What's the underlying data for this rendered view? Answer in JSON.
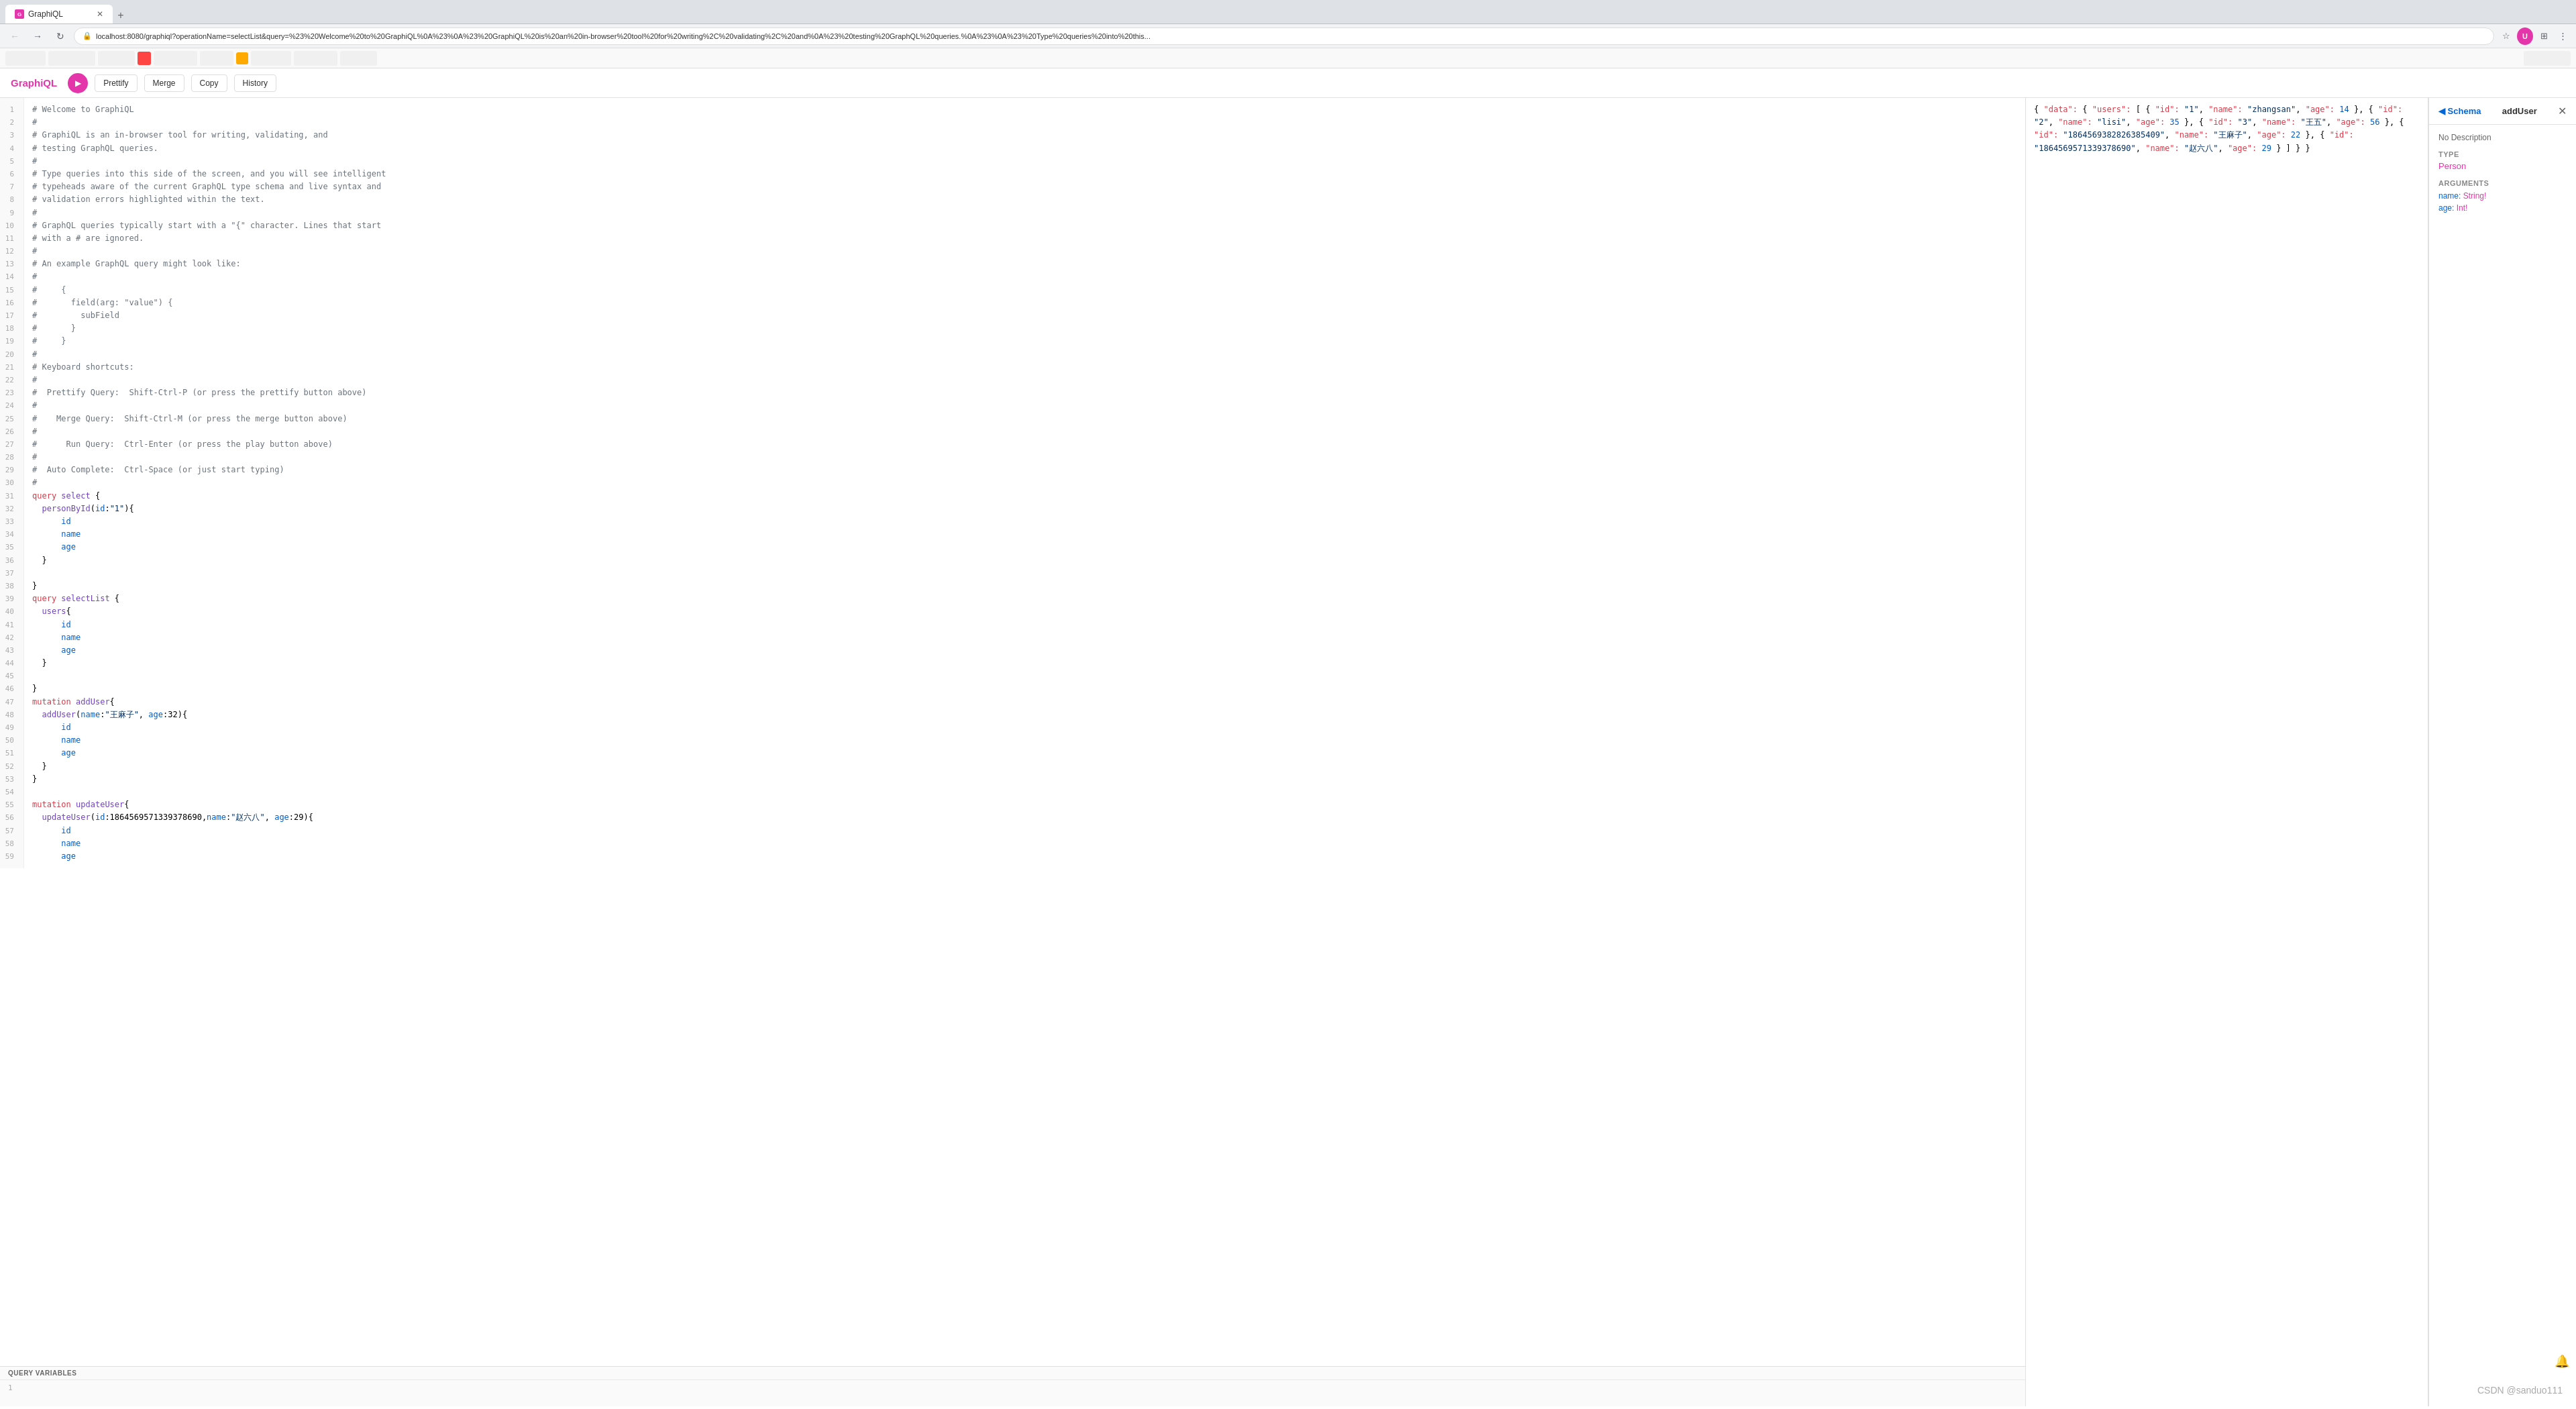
{
  "browser": {
    "tab_title": "GraphiQL",
    "url": "localhost:8080/graphiql?operationName=selectList&query=%23%20Welcome%20to%20GraphiQL%0A%23%0A%23%20GraphiQL%20is%20an%20in-browser%20tool%20for%20writing%2C%20validating%2C%20and%0A%23%20testing%20GraphQL%20queries.%0A%23%0A%23%20Type%20queries%20into%20this..."
  },
  "app": {
    "title": "GraphiQL",
    "play_label": "▶",
    "prettify_label": "Prettify",
    "merge_label": "Merge",
    "copy_label": "Copy",
    "history_label": "History"
  },
  "editor": {
    "content_lines": [
      {
        "num": 1,
        "text": "# Welcome to GraphiQL",
        "type": "comment"
      },
      {
        "num": 2,
        "text": "#",
        "type": "comment"
      },
      {
        "num": 3,
        "text": "# GraphiQL is an in-browser tool for writing, validating, and",
        "type": "comment"
      },
      {
        "num": 4,
        "text": "# testing GraphQL queries.",
        "type": "comment"
      },
      {
        "num": 5,
        "text": "#",
        "type": "comment"
      },
      {
        "num": 6,
        "text": "# Type queries into this side of the screen, and you will see intelligent",
        "type": "comment"
      },
      {
        "num": 7,
        "text": "# typeheads aware of the current GraphQL type schema and live syntax and",
        "type": "comment"
      },
      {
        "num": 8,
        "text": "# validation errors highlighted within the text.",
        "type": "comment"
      },
      {
        "num": 9,
        "text": "#",
        "type": "comment"
      },
      {
        "num": 10,
        "text": "# GraphQL queries typically start with a \"{\" character. Lines that start",
        "type": "comment"
      },
      {
        "num": 11,
        "text": "# with a # are ignored.",
        "type": "comment"
      },
      {
        "num": 12,
        "text": "#",
        "type": "comment"
      },
      {
        "num": 13,
        "text": "# An example GraphQL query might look like:",
        "type": "comment"
      },
      {
        "num": 14,
        "text": "#",
        "type": "comment"
      },
      {
        "num": 15,
        "text": "#     {",
        "type": "comment"
      },
      {
        "num": 16,
        "text": "#       field(arg: \"value\") {",
        "type": "comment"
      },
      {
        "num": 17,
        "text": "#         subField",
        "type": "comment"
      },
      {
        "num": 18,
        "text": "#       }",
        "type": "comment"
      },
      {
        "num": 19,
        "text": "#     }",
        "type": "comment"
      },
      {
        "num": 20,
        "text": "#",
        "type": "comment"
      },
      {
        "num": 21,
        "text": "# Keyboard shortcuts:",
        "type": "comment"
      },
      {
        "num": 22,
        "text": "#",
        "type": "comment"
      },
      {
        "num": 23,
        "text": "#  Prettify Query:  Shift-Ctrl-P (or press the prettify button above)",
        "type": "comment"
      },
      {
        "num": 24,
        "text": "#",
        "type": "comment"
      },
      {
        "num": 25,
        "text": "#    Merge Query:  Shift-Ctrl-M (or press the merge button above)",
        "type": "comment"
      },
      {
        "num": 26,
        "text": "#",
        "type": "comment"
      },
      {
        "num": 27,
        "text": "#      Run Query:  Ctrl-Enter (or press the play button above)",
        "type": "comment"
      },
      {
        "num": 28,
        "text": "#",
        "type": "comment"
      },
      {
        "num": 29,
        "text": "#  Auto Complete:  Ctrl-Space (or just start typing)",
        "type": "comment"
      },
      {
        "num": 30,
        "text": "#",
        "type": "comment"
      },
      {
        "num": 31,
        "text": "query select {",
        "type": "code"
      },
      {
        "num": 32,
        "text": "  personById(id:\"1\"){",
        "type": "code"
      },
      {
        "num": 33,
        "text": "      id",
        "type": "code"
      },
      {
        "num": 34,
        "text": "      name",
        "type": "code"
      },
      {
        "num": 35,
        "text": "      age",
        "type": "code"
      },
      {
        "num": 36,
        "text": "  }",
        "type": "code"
      },
      {
        "num": 37,
        "text": "",
        "type": "code"
      },
      {
        "num": 38,
        "text": "}",
        "type": "code"
      },
      {
        "num": 39,
        "text": "query selectList {",
        "type": "code"
      },
      {
        "num": 40,
        "text": "  users{",
        "type": "code"
      },
      {
        "num": 41,
        "text": "      id",
        "type": "code"
      },
      {
        "num": 42,
        "text": "      name",
        "type": "code"
      },
      {
        "num": 43,
        "text": "      age",
        "type": "code"
      },
      {
        "num": 44,
        "text": "  }",
        "type": "code"
      },
      {
        "num": 45,
        "text": "",
        "type": "code"
      },
      {
        "num": 46,
        "text": "}",
        "type": "code"
      },
      {
        "num": 47,
        "text": "mutation addUser{",
        "type": "code"
      },
      {
        "num": 48,
        "text": "  addUser(name:\"王麻子\", age:32){",
        "type": "code"
      },
      {
        "num": 49,
        "text": "      id",
        "type": "code"
      },
      {
        "num": 50,
        "text": "      name",
        "type": "code"
      },
      {
        "num": 51,
        "text": "      age",
        "type": "code"
      },
      {
        "num": 52,
        "text": "  }",
        "type": "code"
      },
      {
        "num": 53,
        "text": "}",
        "type": "code"
      },
      {
        "num": 54,
        "text": "",
        "type": "code"
      },
      {
        "num": 55,
        "text": "mutation updateUser{",
        "type": "code"
      },
      {
        "num": 56,
        "text": "  updateUser(id:1864569571339378690,name:\"赵六八\", age:29){",
        "type": "code"
      },
      {
        "num": 57,
        "text": "      id",
        "type": "code"
      },
      {
        "num": 58,
        "text": "      name",
        "type": "code"
      },
      {
        "num": 59,
        "text": "      age",
        "type": "code"
      }
    ],
    "query_vars_header": "QUERY VARIABLES",
    "query_vars_line": 1
  },
  "response": {
    "json_text": "{\n  \"data\": {\n    \"users\": [\n      {\n        \"id\": \"1\",\n        \"name\": \"zhangsan\",\n        \"age\": 14\n      },\n      {\n        \"id\": \"2\",\n        \"name\": \"lisi\",\n        \"age\": 35\n      },\n      {\n        \"id\": \"3\",\n        \"name\": \"王五\",\n        \"age\": 56\n      },\n      {\n        \"id\": \"1864569382826385409\",\n        \"name\": \"王麻子\",\n        \"age\": 22\n      },\n      {\n        \"id\": \"1864569571339378690\",\n        \"name\": \"赵六八\",\n        \"age\": 29\n      }\n    ]\n  }\n}"
  },
  "schema": {
    "back_label": "◀ Schema",
    "title": "addUser",
    "close_icon": "✕",
    "no_description": "No Description",
    "type_section": "TYPE",
    "type_value": "Person",
    "arguments_section": "ARGUMENTS",
    "arg_name": "name: String!",
    "arg_age": "age: Int!"
  },
  "watermark": "CSDN @sanduo111"
}
